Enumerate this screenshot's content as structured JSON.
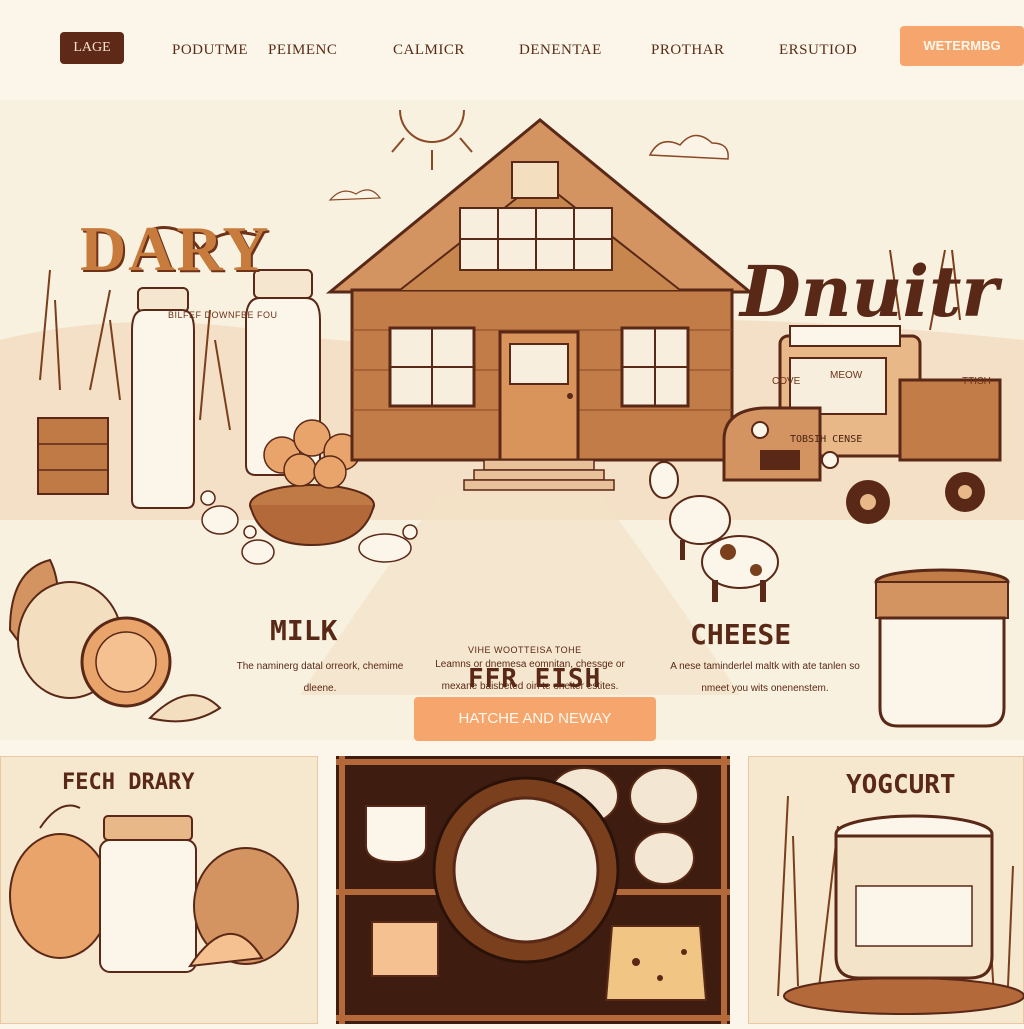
{
  "nav": {
    "logo": "LAGE",
    "items": [
      "PODUTME",
      "PEIMENC",
      "CALMICR",
      "DENENTAE",
      "PROTHAR",
      "ERSUTIOD"
    ],
    "cta": "WETERMBG"
  },
  "hero": {
    "title": "DARY",
    "subtitle": "BILFEF DOWNFBE FOU",
    "script_logo": "Dnuitr",
    "script_tag": "MEOW",
    "left_small": "COVE",
    "right_small": "TTISH",
    "truck_sign": "TOBSIH CENSE"
  },
  "sections": {
    "milk": {
      "title": "MILK",
      "desc": "The naminerg datal orreork, chemime dleene."
    },
    "center": {
      "eyebrow": "VIHE WOOTTEISA TOHE",
      "title": "FFR EISH",
      "button": "HATCHE AND NEWAY",
      "desc": "Leamns or dnemesa eomnitan, chessge or mexane baisbeted oin te oneiter estites."
    },
    "cheese": {
      "title": "CHEESE",
      "desc": "A nese taminderlel maltk with ate tanlen so nmeet you wits onenenstem."
    }
  },
  "cards": [
    {
      "title": "FECH DRARY"
    },
    {
      "title": ""
    },
    {
      "title": "YOGCURT"
    }
  ],
  "colors": {
    "background": "#fbf6e9",
    "ink": "#5a2816",
    "accent": "#f6a66c",
    "wood": "#b3693a"
  }
}
